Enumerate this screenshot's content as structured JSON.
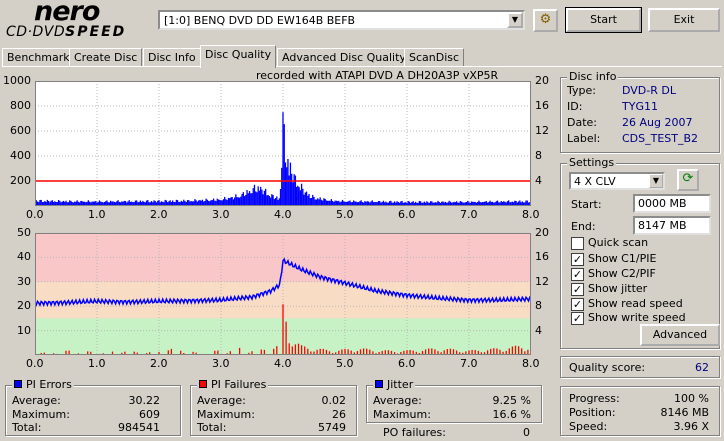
{
  "logo": {
    "line1": "nero",
    "line2a": "CD·DVD",
    "line2b": "SPEED"
  },
  "drive": {
    "selected": "[1:0]  BENQ DVD DD EW164B BEFB"
  },
  "buttons": {
    "start": "Start",
    "exit": "Exit",
    "advanced": "Advanced"
  },
  "tabs": [
    "Benchmark",
    "Create Disc",
    "Disc Info",
    "Disc Quality",
    "Advanced Disc Quality",
    "ScanDisc"
  ],
  "active_tab": "Disc Quality",
  "recorded_with": "recorded with ATAPI    DVD  A   DH20A3P    vXP5R",
  "disc_info": {
    "title": "Disc info",
    "rows": [
      {
        "label": "Type:",
        "value": "DVD-R DL"
      },
      {
        "label": "ID:",
        "value": "TYG11"
      },
      {
        "label": "Date:",
        "value": "26 Aug 2007"
      },
      {
        "label": "Label:",
        "value": "CDS_TEST_B2"
      }
    ]
  },
  "settings": {
    "title": "Settings",
    "speed": "4 X CLV",
    "start_label": "Start:",
    "start_value": "0000 MB",
    "end_label": "End:",
    "end_value": "8147 MB",
    "checks": [
      {
        "label": "Quick scan",
        "checked": false
      },
      {
        "label": "Show C1/PIE",
        "checked": true
      },
      {
        "label": "Show C2/PIF",
        "checked": true
      },
      {
        "label": "Show jitter",
        "checked": true
      },
      {
        "label": "Show read speed",
        "checked": true
      },
      {
        "label": "Show write speed",
        "checked": true
      }
    ]
  },
  "quality": {
    "label": "Quality score:",
    "value": "62"
  },
  "progress": {
    "rows": [
      {
        "label": "Progress:",
        "value": "100 %"
      },
      {
        "label": "Position:",
        "value": "8146 MB"
      },
      {
        "label": "Speed:",
        "value": "3.96 X"
      }
    ]
  },
  "pi_errors": {
    "title": "PI Errors",
    "color": "#0000ff",
    "rows": [
      {
        "label": "Average:",
        "value": "30.22"
      },
      {
        "label": "Maximum:",
        "value": "609"
      },
      {
        "label": "Total:",
        "value": "984541"
      }
    ]
  },
  "pi_failures": {
    "title": "PI Failures",
    "color": "#ff0000",
    "rows": [
      {
        "label": "Average:",
        "value": "0.02"
      },
      {
        "label": "Maximum:",
        "value": "26"
      },
      {
        "label": "Total:",
        "value": "5749"
      }
    ]
  },
  "jitter": {
    "title": "Jitter",
    "color": "#0000ff",
    "rows": [
      {
        "label": "Average:",
        "value": "9.25 %"
      },
      {
        "label": "Maximum:",
        "value": "16.6 %"
      }
    ]
  },
  "po_failures": {
    "label": "PO failures:",
    "value": "0"
  },
  "chart_data": [
    {
      "type": "area",
      "series": [
        {
          "name": "PI Errors",
          "color": "#0000ff",
          "x": [
            0.0,
            0.5,
            1.0,
            1.5,
            2.0,
            2.5,
            3.0,
            3.3,
            3.6,
            3.8,
            3.95,
            4.0,
            4.05,
            4.1,
            4.2,
            4.35,
            4.5,
            4.8,
            5.0,
            5.5,
            6.0,
            6.5,
            7.0,
            7.5,
            8.0
          ],
          "y": [
            45,
            40,
            38,
            40,
            42,
            45,
            55,
            85,
            160,
            90,
            60,
            680,
            450,
            340,
            220,
            120,
            70,
            45,
            40,
            38,
            35,
            35,
            35,
            38,
            40
          ]
        },
        {
          "name": "Read speed",
          "color": "#ff0000",
          "x": [
            0.0,
            3.8,
            4.0,
            8.0
          ],
          "y": [
            4,
            4,
            4,
            4
          ]
        }
      ],
      "xlim": [
        0,
        8
      ],
      "ylim_left": [
        0,
        1000
      ],
      "ylim_right": [
        0,
        20
      ],
      "xticks": [
        "0.0",
        "1.0",
        "2.0",
        "3.0",
        "4.0",
        "5.0",
        "6.0",
        "7.0",
        "8.0"
      ],
      "yticks_left": [
        "1000",
        "800",
        "600",
        "400",
        "200"
      ],
      "yticks_right": [
        "20",
        "16",
        "12",
        "8",
        "4"
      ]
    },
    {
      "type": "bar",
      "series": [
        {
          "name": "PI Failures",
          "color": "#ff0000",
          "x": [
            0.2,
            0.6,
            1.1,
            1.4,
            1.8,
            2.3,
            2.6,
            3.0,
            3.3,
            3.6,
            3.9,
            4.0,
            4.05,
            4.1,
            4.2,
            4.3,
            4.5,
            4.8,
            5.2,
            5.6,
            6.0,
            6.5,
            7.0,
            7.5,
            7.8
          ],
          "y": [
            1,
            2,
            1,
            2,
            1,
            3,
            1,
            2,
            3,
            2,
            4,
            22,
            18,
            10,
            6,
            4,
            3,
            2,
            3,
            2,
            2,
            3,
            2,
            3,
            4
          ]
        },
        {
          "name": "Jitter",
          "color": "#0000ff",
          "x": [
            0.0,
            0.5,
            1.0,
            1.5,
            2.0,
            2.5,
            3.0,
            3.5,
            3.8,
            3.95,
            4.0,
            4.1,
            4.3,
            4.6,
            5.0,
            5.5,
            6.0,
            6.5,
            7.0,
            7.5,
            8.0
          ],
          "y": [
            8.5,
            8.6,
            8.8,
            8.7,
            8.8,
            8.9,
            9.0,
            9.5,
            10.5,
            11.5,
            15.5,
            15.0,
            14.0,
            12.8,
            11.8,
            10.5,
            9.8,
            9.3,
            9.0,
            9.0,
            9.2
          ]
        }
      ],
      "xlim": [
        0,
        8
      ],
      "ylim_left": [
        0,
        50
      ],
      "ylim_right": [
        0,
        20
      ],
      "xticks": [
        "0.0",
        "1.0",
        "2.0",
        "3.0",
        "4.0",
        "5.0",
        "6.0",
        "7.0",
        "8.0"
      ],
      "yticks_left": [
        "50",
        "40",
        "30",
        "20",
        "10"
      ],
      "yticks_right": [
        "20",
        "16",
        "12",
        "8",
        "4"
      ]
    }
  ]
}
